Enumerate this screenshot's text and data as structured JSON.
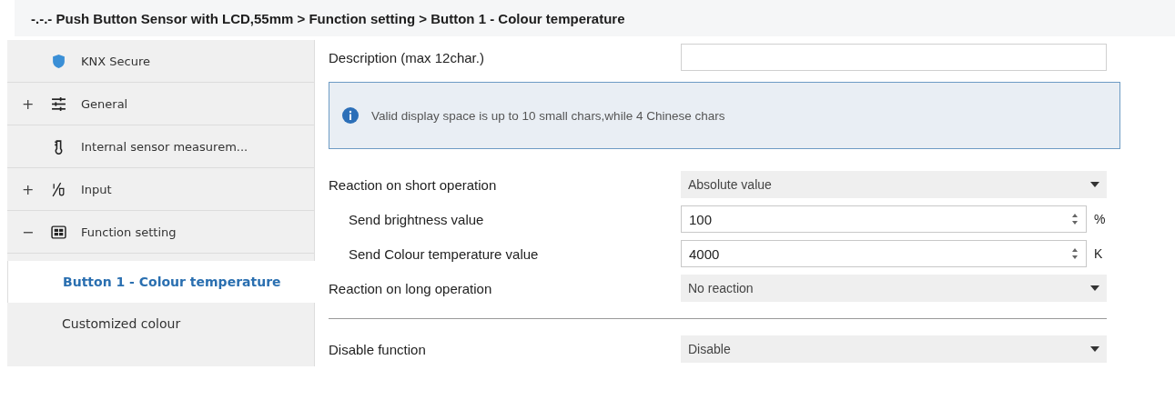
{
  "breadcrumb": "-.-.- Push Button Sensor with LCD,55mm > Function setting > Button 1 - Colour temperature",
  "sidebar": {
    "items": [
      {
        "label": "KNX Secure"
      },
      {
        "label": "General",
        "expander": "+"
      },
      {
        "label": "Internal sensor measurem..."
      },
      {
        "label": "Input",
        "expander": "+"
      },
      {
        "label": "Function setting",
        "expander": "−",
        "children": [
          {
            "label": "Button 1 - Colour temperature",
            "selected": true
          },
          {
            "label": "Customized colour",
            "selected": false
          }
        ]
      }
    ]
  },
  "parameters": [
    {
      "kind": "text",
      "label": "Description (max 12char.)",
      "indented": false
    },
    {
      "kind": "info",
      "text": "Valid display space is up to 10 small chars,while 4 Chinese chars"
    },
    {
      "kind": "dropdown",
      "label": "Reaction on short operation",
      "value": "Absolute value",
      "indented": false
    },
    {
      "kind": "spin",
      "label": "Send brightness value",
      "value": "100",
      "unit": "%",
      "indented": true
    },
    {
      "kind": "spin",
      "label": "Send Colour temperature value",
      "value": "4000",
      "unit": "K",
      "indented": true
    },
    {
      "kind": "dropdown",
      "label": "Reaction on long operation",
      "value": "No reaction",
      "indented": false
    },
    {
      "kind": "divider"
    },
    {
      "kind": "dropdown",
      "label": "Disable function",
      "value": "Disable",
      "indented": false
    }
  ]
}
